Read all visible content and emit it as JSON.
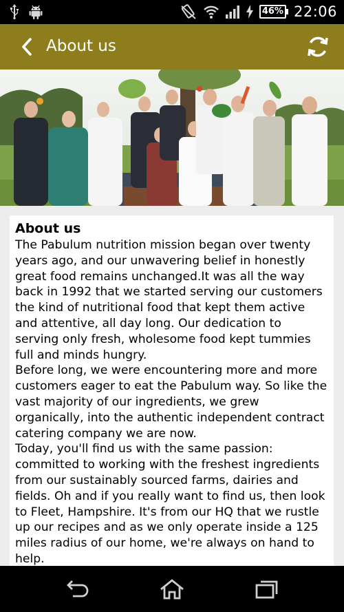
{
  "status_bar": {
    "icons": [
      "usb-icon",
      "android-icon",
      "silent-mode-icon",
      "wifi-icon",
      "signal-icon",
      "charging-icon"
    ],
    "battery": "46%",
    "time": "22:06"
  },
  "app_bar": {
    "title": "About us",
    "back_icon": "chevron-left-icon",
    "refresh_icon": "refresh-icon",
    "color": "#8d7d1c"
  },
  "hero": {
    "subject": "team photo with people throwing vegetables in a field"
  },
  "content": {
    "heading": "About us",
    "paragraphs": [
      "The Pabulum nutrition mission began over twenty years ago, and our unwavering belief in honestly great food remains unchanged.It was all the way back in 1992 that we started serving our customers the kind of nutritional food that kept them active and attentive, all day long. Our dedication to serving only fresh, wholesome food kept tummies full and minds hungry.",
      "Before long, we were encountering more and more customers eager to eat the Pabulum way. So like the vast majority of our ingredients, we grew organically, into the authentic independent contract catering company we are now.",
      "Today, you'll find us with the same passion: committed to working with the freshest ingredients from our sustainably sourced farms, dairies and fields. Oh and if you really want to find us, then look to Fleet, Hampshire. It's from our HQ that we rustle up our recipes and as we only operate inside a 125 miles radius of our home, we're always on hand to help."
    ]
  },
  "nav_bar": {
    "icons": [
      "back-icon",
      "home-icon",
      "recent-apps-icon"
    ]
  }
}
